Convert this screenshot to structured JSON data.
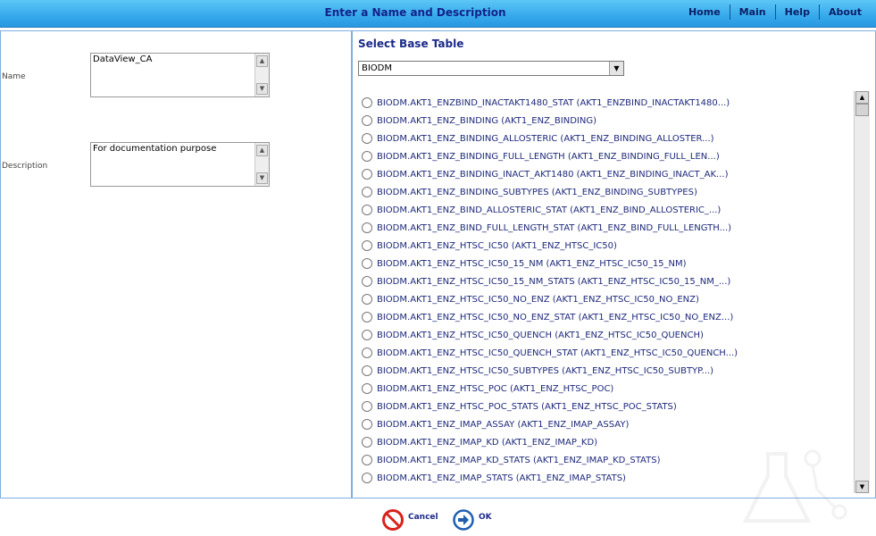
{
  "header": {
    "title": "Enter a Name and Description",
    "nav": [
      "Home",
      "Main",
      "Help",
      "About"
    ]
  },
  "form": {
    "name_label": "Name",
    "name_value": "DataView_CA",
    "description_label": "Description",
    "description_value": "For documentation purpose"
  },
  "base_table": {
    "title": "Select Base Table",
    "schema_selected": "BIODM",
    "items": [
      "BIODM.AKT1_ENZBIND_INACTAKT1480_STAT (AKT1_ENZBIND_INACTAKT1480...)",
      "BIODM.AKT1_ENZ_BINDING (AKT1_ENZ_BINDING)",
      "BIODM.AKT1_ENZ_BINDING_ALLOSTERIC (AKT1_ENZ_BINDING_ALLOSTER...)",
      "BIODM.AKT1_ENZ_BINDING_FULL_LENGTH (AKT1_ENZ_BINDING_FULL_LEN...)",
      "BIODM.AKT1_ENZ_BINDING_INACT_AKT1480 (AKT1_ENZ_BINDING_INACT_AK...)",
      "BIODM.AKT1_ENZ_BINDING_SUBTYPES (AKT1_ENZ_BINDING_SUBTYPES)",
      "BIODM.AKT1_ENZ_BIND_ALLOSTERIC_STAT (AKT1_ENZ_BIND_ALLOSTERIC_...)",
      "BIODM.AKT1_ENZ_BIND_FULL_LENGTH_STAT (AKT1_ENZ_BIND_FULL_LENGTH...)",
      "BIODM.AKT1_ENZ_HTSC_IC50 (AKT1_ENZ_HTSC_IC50)",
      "BIODM.AKT1_ENZ_HTSC_IC50_15_NM (AKT1_ENZ_HTSC_IC50_15_NM)",
      "BIODM.AKT1_ENZ_HTSC_IC50_15_NM_STATS (AKT1_ENZ_HTSC_IC50_15_NM_...)",
      "BIODM.AKT1_ENZ_HTSC_IC50_NO_ENZ (AKT1_ENZ_HTSC_IC50_NO_ENZ)",
      "BIODM.AKT1_ENZ_HTSC_IC50_NO_ENZ_STAT (AKT1_ENZ_HTSC_IC50_NO_ENZ...)",
      "BIODM.AKT1_ENZ_HTSC_IC50_QUENCH (AKT1_ENZ_HTSC_IC50_QUENCH)",
      "BIODM.AKT1_ENZ_HTSC_IC50_QUENCH_STAT (AKT1_ENZ_HTSC_IC50_QUENCH...)",
      "BIODM.AKT1_ENZ_HTSC_IC50_SUBTYPES (AKT1_ENZ_HTSC_IC50_SUBTYP...)",
      "BIODM.AKT1_ENZ_HTSC_POC (AKT1_ENZ_HTSC_POC)",
      "BIODM.AKT1_ENZ_HTSC_POC_STATS (AKT1_ENZ_HTSC_POC_STATS)",
      "BIODM.AKT1_ENZ_IMAP_ASSAY (AKT1_ENZ_IMAP_ASSAY)",
      "BIODM.AKT1_ENZ_IMAP_KD (AKT1_ENZ_IMAP_KD)",
      "BIODM.AKT1_ENZ_IMAP_KD_STATS (AKT1_ENZ_IMAP_KD_STATS)",
      "BIODM.AKT1_ENZ_IMAP_STATS (AKT1_ENZ_IMAP_STATS)"
    ]
  },
  "footer": {
    "cancel_label": "Cancel",
    "ok_label": "OK"
  },
  "icons": {
    "cancel": "no-entry-icon",
    "ok": "arrow-right-circle-icon",
    "watermark": "flask-molecule-icon"
  },
  "colors": {
    "header_bar": "#36a9ec",
    "title_text": "#12238a",
    "panel_border": "#7fb0e0",
    "cancel_icon": "#d8231b",
    "ok_icon": "#1f5fb0"
  }
}
